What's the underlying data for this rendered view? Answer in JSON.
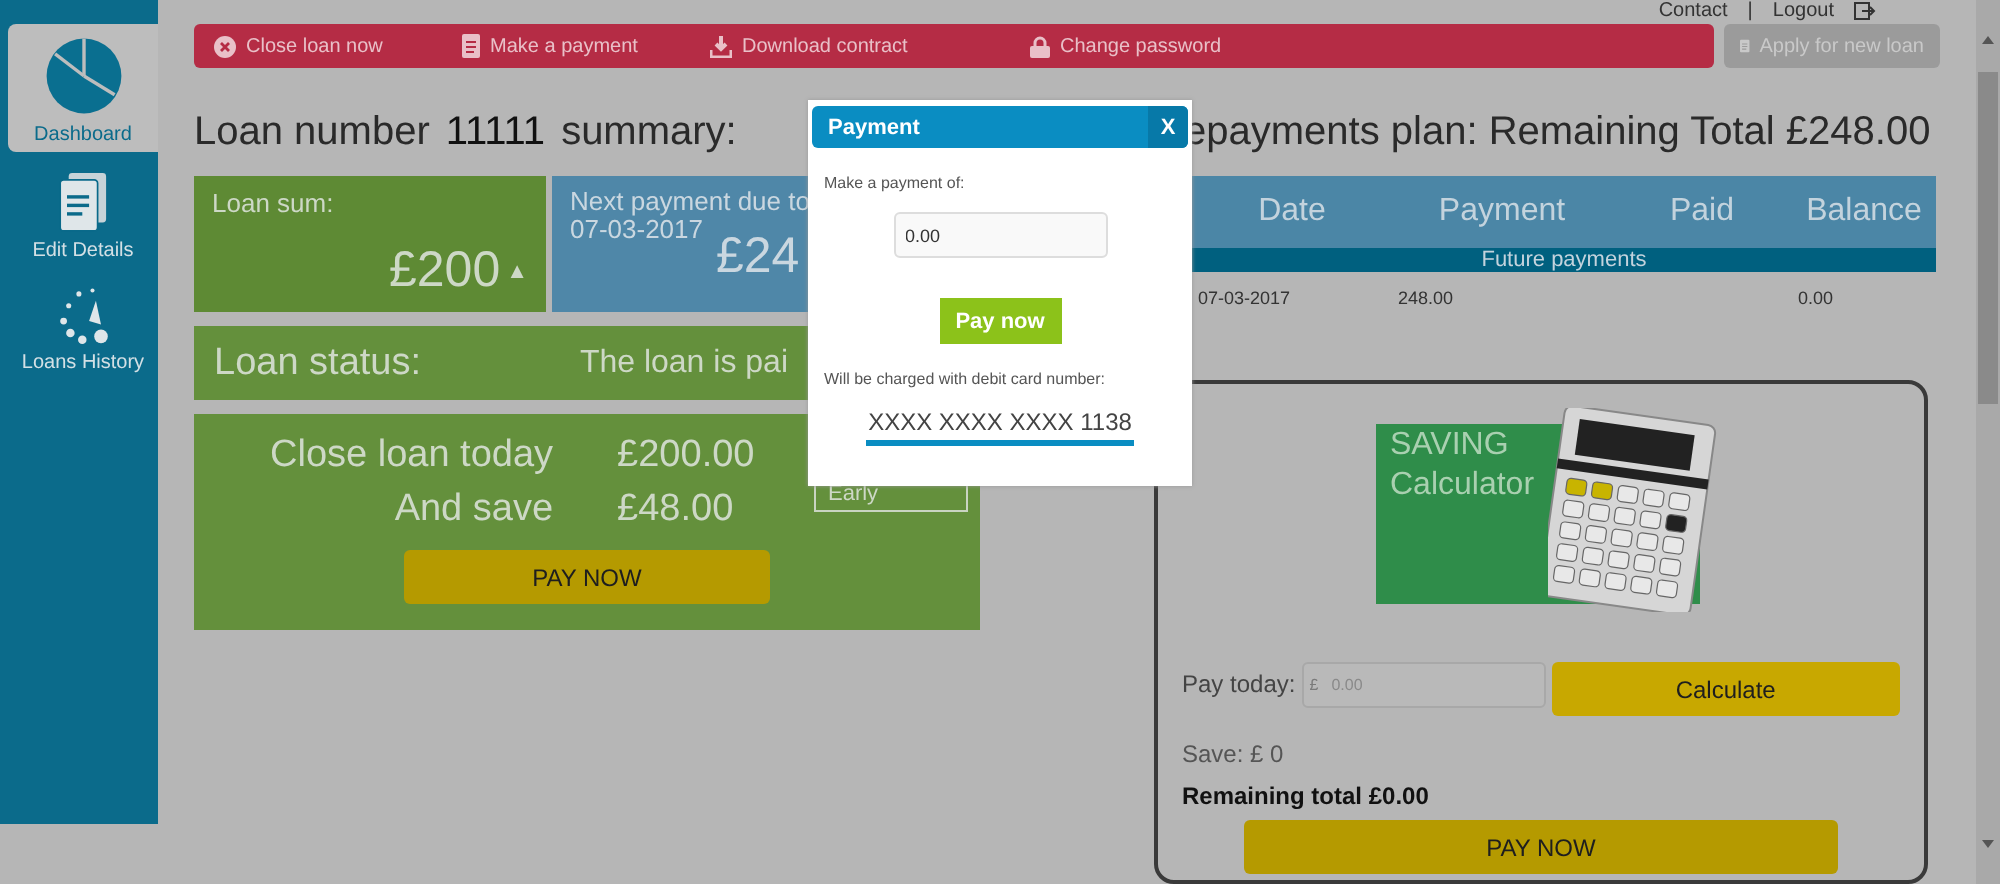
{
  "header_links": [
    {
      "label": "Contact"
    },
    {
      "label": "Logout"
    }
  ],
  "header_separator": "|",
  "sidebar": {
    "items": [
      {
        "label": "Dashboard",
        "selected": true
      },
      {
        "label": "Edit Details",
        "selected": false
      },
      {
        "label": "Loans History",
        "selected": false
      }
    ]
  },
  "action_bar": {
    "items": [
      {
        "label": "Close loan now"
      },
      {
        "label": "Make a payment"
      },
      {
        "label": "Download contract"
      },
      {
        "label": "Change password"
      }
    ]
  },
  "apply_button": {
    "label": "Apply for new loan",
    "disabled": true
  },
  "summary": {
    "title_prefix": "Loan number",
    "loan_number": "11111",
    "title_suffix": "summary:",
    "loan_sum": {
      "label": "Loan sum:",
      "value": "£200",
      "trend": "▲"
    },
    "next_payment": {
      "label": "Next payment due to",
      "date": "07-03-2017",
      "amount": "£24"
    },
    "status": {
      "label": "Loan status:",
      "value": "The loan is pai"
    },
    "close_offer": {
      "rows": [
        {
          "label": "Close loan today",
          "value": "£200.00"
        },
        {
          "label": "And save",
          "value": "£48.00"
        }
      ],
      "button": "PAY NOW",
      "early_label": "Early"
    }
  },
  "plan": {
    "title": "epayments plan: Remaining Total £248.00",
    "columns": [
      "Date",
      "Payment",
      "Paid",
      "Balance"
    ],
    "group": "Future payments",
    "rows": [
      {
        "date": "07-03-2017",
        "payment": "248.00",
        "balance": "0.00"
      }
    ]
  },
  "calculator": {
    "banner": [
      "SAVING",
      "Calculator"
    ],
    "pay_label": "Pay today:",
    "currency": "£",
    "placeholder": "0.00",
    "calculate_button": "Calculate",
    "save": "Save: £ 0",
    "remaining": "Remaining total £0.00",
    "button": "PAY NOW"
  },
  "modal": {
    "title": "Payment",
    "close": "X",
    "prompt": "Make a payment of:",
    "amount": "0.00",
    "button": "Pay now",
    "card_label": "Will be charged with debit card number:",
    "card_number": "XXXX XXXX XXXX 1138"
  }
}
